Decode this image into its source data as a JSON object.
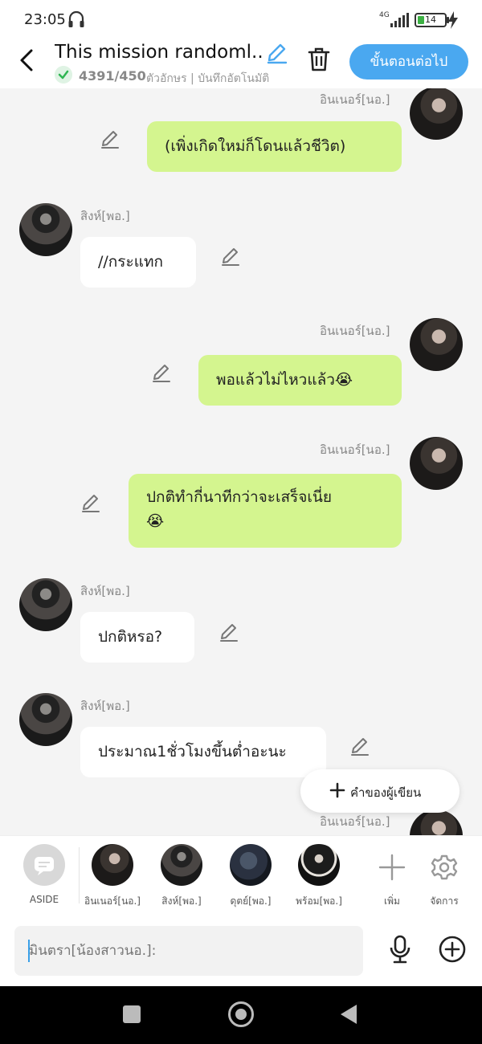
{
  "status_bar": {
    "time": "23:05",
    "network": "4G",
    "battery": "14"
  },
  "header": {
    "title": "This mission randoml...",
    "char_count": "4391/450",
    "meta": "ตัวอักษร | บันทึกอัตโนมัติ",
    "next_label": "ขั้นตอนต่อไป"
  },
  "messages": [
    {
      "speaker": "อินเนอร์[นอ.]",
      "side": "right",
      "text": "(เพิ่งเกิดใหม่ก็โดนแล้วชีวิต)"
    },
    {
      "speaker": "สิงห์[พอ.]",
      "side": "left",
      "text": "//กระแทก"
    },
    {
      "speaker": "อินเนอร์[นอ.]",
      "side": "right",
      "text": "พอแล้วไม่ไหวแล้ว😭"
    },
    {
      "speaker": "อินเนอร์[นอ.]",
      "side": "right",
      "line1": "ปกติทำกี่นาทีกว่าจะเสร็จเนี่ย",
      "line2": "😭"
    },
    {
      "speaker": "สิงห์[พอ.]",
      "side": "left",
      "text": "ปกติหรอ?"
    },
    {
      "speaker": "สิงห์[พอ.]",
      "side": "left",
      "text": "ประมาณ1ชั่วโมงขึ้นต่ำอะนะ"
    },
    {
      "speaker": "อินเนอร์[นอ.]",
      "side": "right",
      "text": ""
    }
  ],
  "author_note_label": "คำของผู้เขียน",
  "characters": [
    {
      "label": "ASIDE"
    },
    {
      "label": "อินเนอร์[นอ.]"
    },
    {
      "label": "สิงห์[พอ.]"
    },
    {
      "label": "ดุตย์[พอ.]"
    },
    {
      "label": "พร้อม[พอ.]"
    },
    {
      "label": "เพิ่ม"
    },
    {
      "label": "จัดการ"
    }
  ],
  "input": {
    "placeholder": "มินตรา[น้องสาวนอ.]:"
  },
  "colors": {
    "accent": "#4aa8f0",
    "my_bubble": "#d4f58f",
    "their_bubble": "#ffffff"
  }
}
